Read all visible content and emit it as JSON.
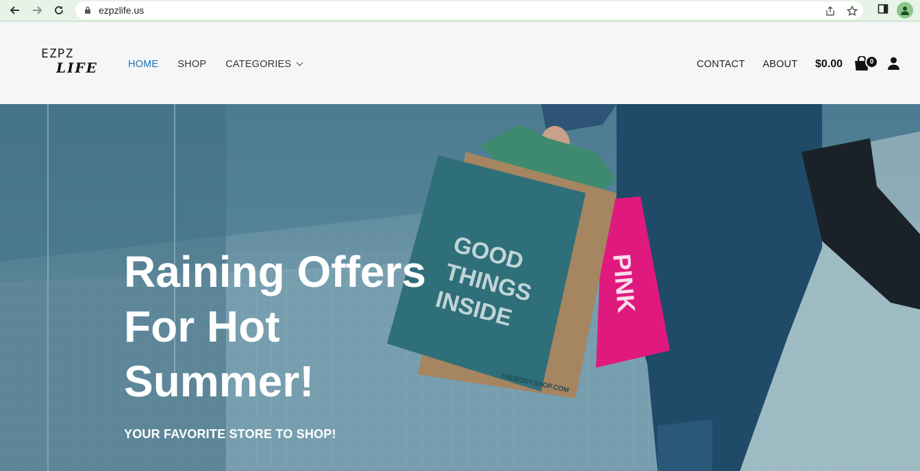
{
  "browser": {
    "url": "ezpzlife.us"
  },
  "header": {
    "logo_top": "EZPZ",
    "logo_bottom": "LIFE",
    "nav_left": [
      {
        "label": "HOME",
        "active": true
      },
      {
        "label": "SHOP",
        "active": false
      },
      {
        "label": "CATEGORIES",
        "active": false
      }
    ],
    "nav_right": [
      {
        "label": "CONTACT"
      },
      {
        "label": "ABOUT"
      }
    ],
    "cart_total": "$0.00",
    "cart_count": "0"
  },
  "hero": {
    "title": "Raining Offers For Hot Summer!",
    "subtitle": "YOUR FAVORITE STORE TO SHOP!",
    "bag_green_text": "GOOD THINGS INSIDE",
    "bag_green_site": "THEBODYSHOP.COM",
    "bag_pink_text": "PINK"
  },
  "colors": {
    "active_nav": "#1f6fb2",
    "header_bg": "#f5f6f8",
    "hero_tint": "#4f7f95",
    "bag_pink": "#e0197e",
    "bag_green": "#2f6f79"
  },
  "icons": [
    "back-arrow-icon",
    "forward-arrow-icon",
    "reload-icon",
    "lock-icon",
    "share-icon",
    "star-icon",
    "sidebar-icon",
    "profile-icon",
    "chevron-down-icon",
    "shopping-bag-icon",
    "user-icon"
  ]
}
